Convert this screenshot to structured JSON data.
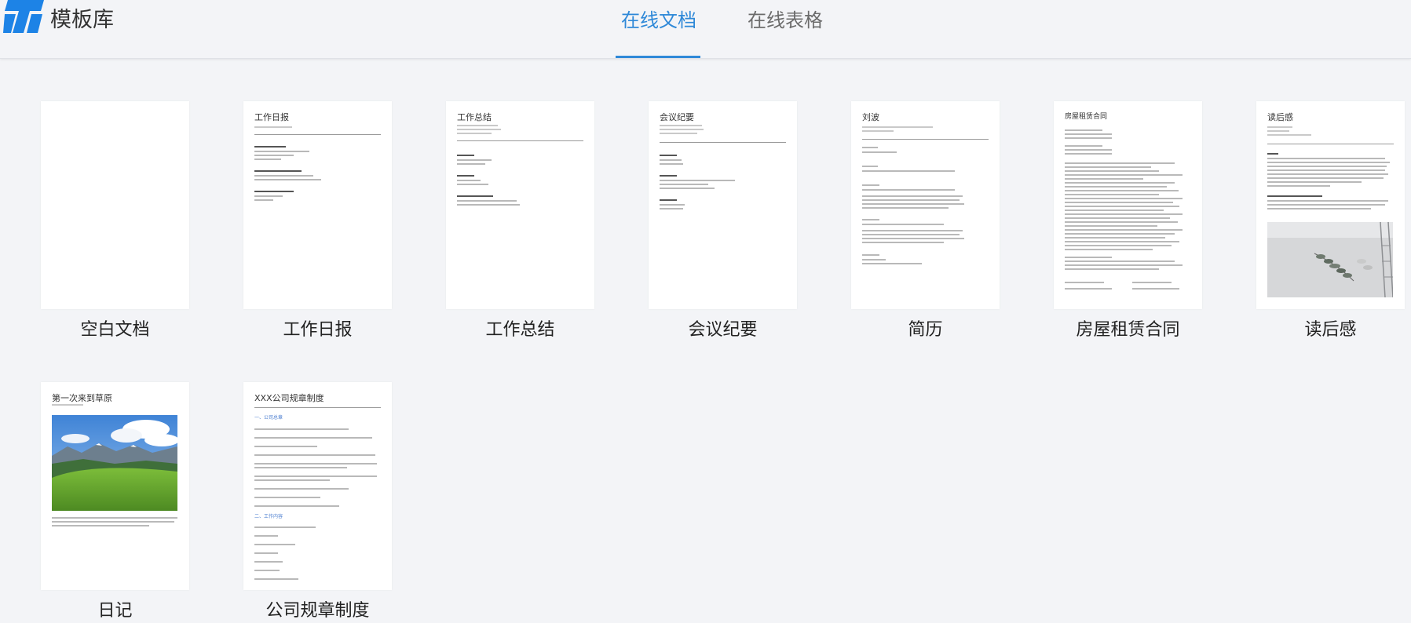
{
  "header": {
    "app_title": "模板库",
    "tabs": [
      {
        "label": "在线文档",
        "active": true
      },
      {
        "label": "在线表格",
        "active": false
      }
    ],
    "accent_color": "#2f89d8",
    "logo_icon": "t-logo-icon"
  },
  "templates": [
    {
      "label": "空白文档"
    },
    {
      "label": "工作日报",
      "doc_title": "工作日报"
    },
    {
      "label": "工作总结",
      "doc_title": "工作总结"
    },
    {
      "label": "会议纪要",
      "doc_title": "会议纪要"
    },
    {
      "label": "简历",
      "doc_title": "刘波"
    },
    {
      "label": "房屋租赁合同",
      "doc_title": "房屋租赁合同"
    },
    {
      "label": "读后感",
      "doc_title": "读后感"
    },
    {
      "label": "日记",
      "doc_title": "第一次来到草原"
    },
    {
      "label": "公司规章制度",
      "doc_title": "XXX公司规章制度",
      "section_1": "一、公司总章",
      "section_2": "二、工作内容"
    }
  ]
}
